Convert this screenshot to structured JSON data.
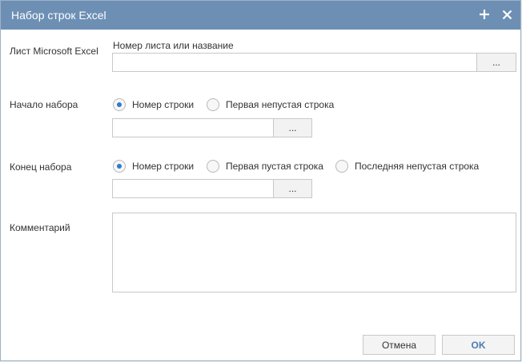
{
  "dialog": {
    "title": "Набор строк Excel",
    "add_icon": "plus-icon",
    "close_icon": "close-icon"
  },
  "sheet": {
    "label": "Лист Microsoft Excel",
    "sublabel": "Номер листа или название",
    "value": "",
    "browse_label": "..."
  },
  "start": {
    "label": "Начало набора",
    "options": [
      "Номер строки",
      "Первая непустая строка"
    ],
    "selected": "Номер строки",
    "value": "",
    "browse_label": "..."
  },
  "end": {
    "label": "Конец набора",
    "options": [
      "Номер строки",
      "Первая пустая строка",
      "Последняя непустая строка"
    ],
    "selected": "Номер строки",
    "value": "",
    "browse_label": "..."
  },
  "comment": {
    "label": "Комментарий",
    "value": ""
  },
  "footer": {
    "cancel_label": "Отмена",
    "ok_label": "OK"
  },
  "colors": {
    "titlebar": "#6d8fb4",
    "radio_selected": "#2d7bd4",
    "ok_text": "#4c7bb0"
  }
}
